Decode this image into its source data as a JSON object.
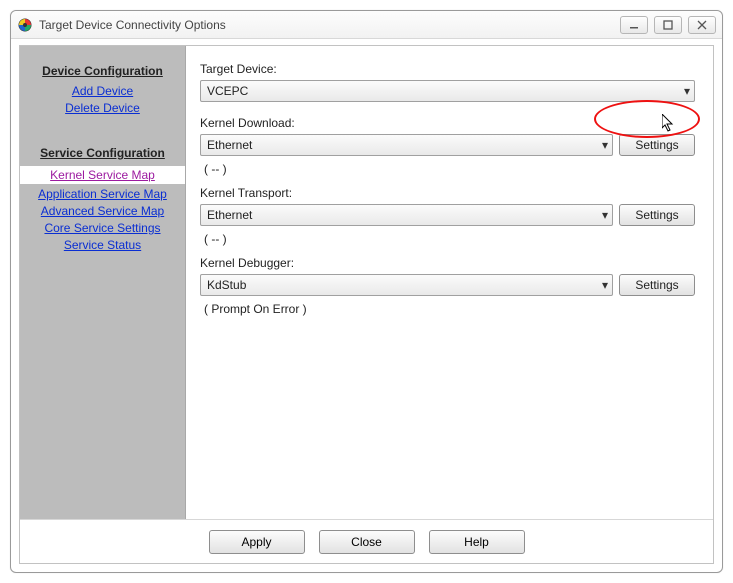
{
  "window": {
    "title": "Target Device Connectivity Options"
  },
  "sidebar": {
    "heading1": "Device Configuration",
    "addDevice": "Add Device",
    "deleteDevice": "Delete Device",
    "heading2": "Service Configuration",
    "kernelServiceMap": "Kernel Service Map",
    "appServiceMap": "Application Service Map",
    "advServiceMap": "Advanced Service Map",
    "coreServiceSettings": "Core Service Settings",
    "serviceStatus": "Service Status"
  },
  "content": {
    "targetDeviceLabel": "Target Device:",
    "targetDeviceValue": "VCEPC",
    "kernelDownloadLabel": "Kernel Download:",
    "kernelDownloadValue": "Ethernet",
    "kernelDownloadSettings": "Settings",
    "kernelDownloadHint": "( -- )",
    "kernelTransportLabel": "Kernel Transport:",
    "kernelTransportValue": "Ethernet",
    "kernelTransportSettings": "Settings",
    "kernelTransportHint": "( -- )",
    "kernelDebuggerLabel": "Kernel Debugger:",
    "kernelDebuggerValue": "KdStub",
    "kernelDebuggerSettings": "Settings",
    "kernelDebuggerHint": "( Prompt On Error )"
  },
  "footer": {
    "apply": "Apply",
    "close": "Close",
    "help": "Help"
  }
}
